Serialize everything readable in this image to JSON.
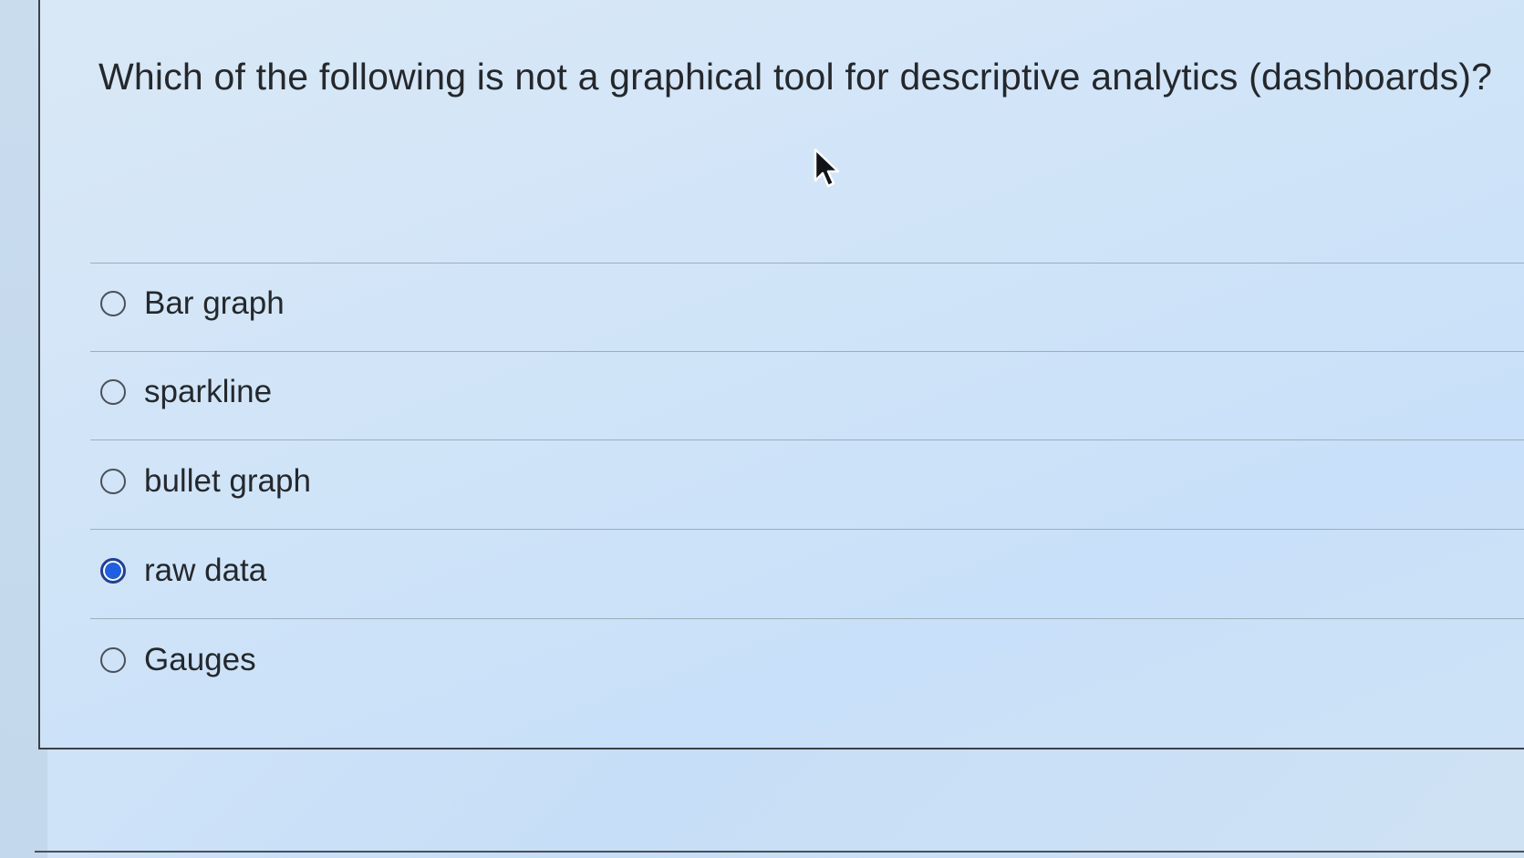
{
  "question": {
    "text": "Which of the following is not a graphical tool for descriptive analytics (dashboards)?"
  },
  "options": [
    {
      "label": "Bar graph",
      "selected": false
    },
    {
      "label": "sparkline",
      "selected": false
    },
    {
      "label": "bullet graph",
      "selected": false
    },
    {
      "label": "raw data",
      "selected": true
    },
    {
      "label": "Gauges",
      "selected": false
    }
  ],
  "colors": {
    "selected_radio": "#1e5fe6",
    "text": "#24282c",
    "background": "#cfe3f8"
  },
  "icons": {
    "cursor": "mouse-pointer-icon"
  }
}
